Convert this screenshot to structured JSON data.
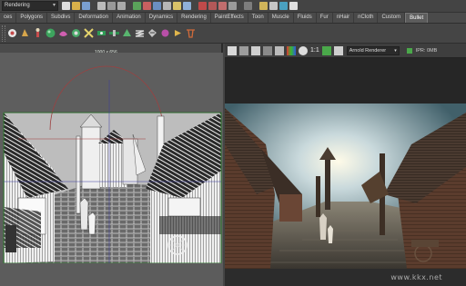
{
  "statusline": {
    "mode": "Rendering"
  },
  "shelf": {
    "tabs": [
      {
        "label": "ces"
      },
      {
        "label": "Polygons"
      },
      {
        "label": "Subdivs"
      },
      {
        "label": "Deformation"
      },
      {
        "label": "Animation"
      },
      {
        "label": "Dynamics"
      },
      {
        "label": "Rendering"
      },
      {
        "label": "PaintEffects"
      },
      {
        "label": "Toon"
      },
      {
        "label": "Muscle"
      },
      {
        "label": "Fluids"
      },
      {
        "label": "Fur"
      },
      {
        "label": "nHair"
      },
      {
        "label": "nCloth"
      },
      {
        "label": "Custom"
      },
      {
        "label": "Bullet"
      }
    ],
    "active_tab": "Bullet"
  },
  "viewport": {
    "resolution": "1000 x 656"
  },
  "render_view": {
    "zoom": "1:1",
    "renderer": "Arnold Renderer",
    "ipr_label": "IPR: 0MB"
  },
  "watermark": "www.kkx.net"
}
